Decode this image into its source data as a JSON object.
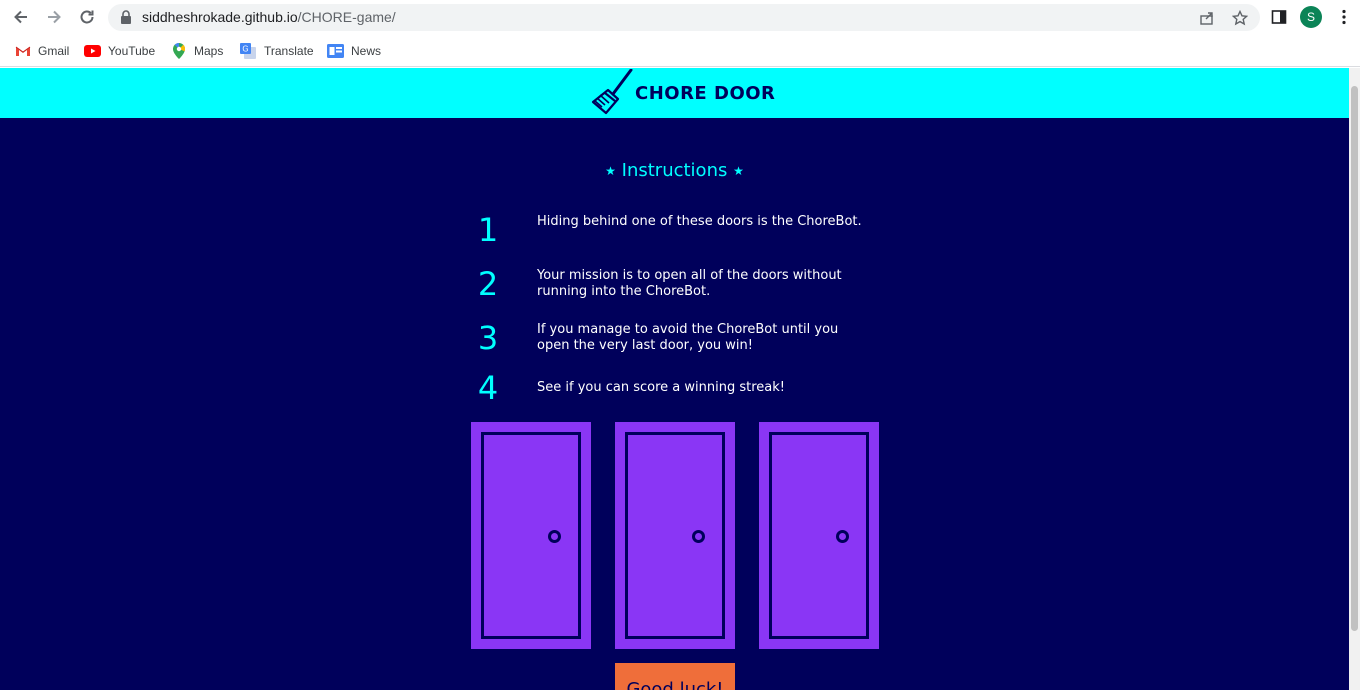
{
  "browser": {
    "url_domain": "siddheshrokade.github.io",
    "url_path": "/CHORE-game/",
    "profile_initial": "S"
  },
  "bookmarks": [
    {
      "label": "Gmail",
      "icon": "gmail-icon"
    },
    {
      "label": "YouTube",
      "icon": "youtube-icon"
    },
    {
      "label": "Maps",
      "icon": "maps-icon"
    },
    {
      "label": "Translate",
      "icon": "translate-icon"
    },
    {
      "label": "News",
      "icon": "news-icon"
    }
  ],
  "page": {
    "title": "CHORE DOOR",
    "logo_icon": "broom-icon",
    "instructions_heading": "Instructions",
    "star_glyph": "★",
    "steps": [
      {
        "number": "1",
        "text": "Hiding behind one of these doors is the ChoreBot."
      },
      {
        "number": "2",
        "text": "Your mission is to open all of the doors without running into the ChoreBot."
      },
      {
        "number": "3",
        "text": "If you manage to avoid the ChoreBot until you open the very last door, you win!"
      },
      {
        "number": "4",
        "text": "See if you can score a winning streak!"
      }
    ],
    "start_button": "Good luck!",
    "colors": {
      "header_bg": "#00ffff",
      "page_bg": "#00005b",
      "accent": "#00ffff",
      "door": "#8a36f5",
      "button": "#ef6e3a"
    }
  }
}
